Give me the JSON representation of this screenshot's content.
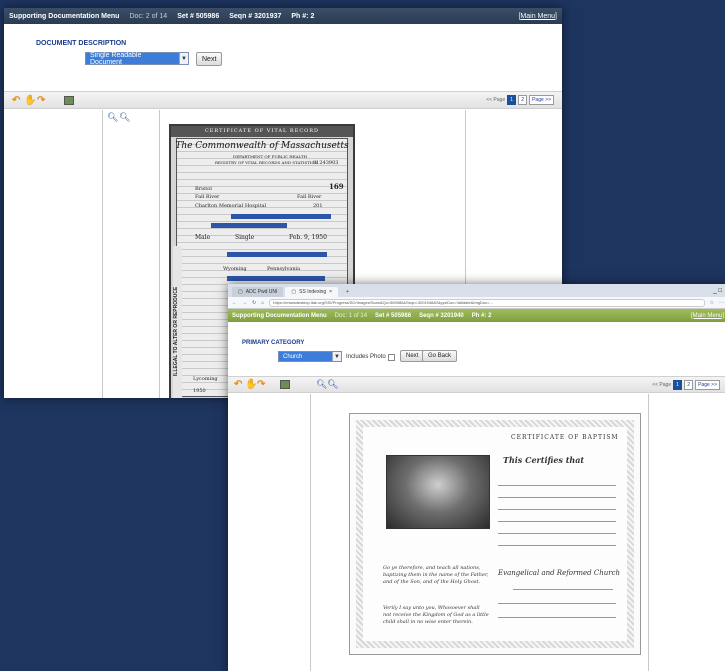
{
  "back_window": {
    "header": {
      "menu_title": "Supporting Documentation Menu",
      "doc_count": "Doc: 2 of 14",
      "set": "Set # 505986",
      "seqn": "Seqn # 3201937",
      "ph": "Ph #: 2",
      "main_menu": "[Main Menu]"
    },
    "section_label": "DOCUMENT DESCRIPTION",
    "select_value": "Single Readable Document",
    "next_button": "Next",
    "pager": {
      "prev": "<< Page",
      "pages": [
        "1",
        "2"
      ],
      "next": "Page >>"
    },
    "document": {
      "top_banner": "CERTIFICATE OF VITAL RECORD",
      "commonwealth": "The Commonwealth of Massachusetts",
      "dept": "DEPARTMENT OF PUBLIC HEALTH",
      "registry": "REGISTRY OF VITAL RECORDS AND STATISTICS",
      "number_top": "81243903",
      "number_right": "169",
      "side_text": "ILLEGAL TO ALTER OR REPRODUCE",
      "fields": [
        "Bristol",
        "Fall River",
        "Fall River",
        "Charlton Memorial Hospital",
        "201",
        "Male",
        "Single",
        "Feb. 9, 1950",
        "Wyoming",
        "Pennsylvania",
        "Lycoming",
        "1950"
      ]
    }
  },
  "front_window": {
    "browser": {
      "tab1": "ADC Pwd UNI",
      "tab2": "SS Indexing",
      "url": "https://emwsdesktop.ilae.org/SSI/Progress/SO/Images/Scan&Qc=505986&Seqn=3201948&SkypeDoc=Validate&ImgDoc=...",
      "window_controls": "_ □"
    },
    "header": {
      "menu_title": "Supporting Documentation Menu",
      "doc_count": "Doc: 1 of 14",
      "set": "Set # 505986",
      "seqn": "Seqn # 3201940",
      "ph": "Ph #: 2",
      "main_menu": "[Main Menu]"
    },
    "section_label": "PRIMARY CATEGORY",
    "select_value": "Church",
    "includes_photo_label": "Includes Photo",
    "next_button": "Next",
    "go_back_button": "Go Back",
    "pager": {
      "prev": "<< Page",
      "pages": [
        "1",
        "2"
      ],
      "next": "Page >>"
    },
    "document": {
      "title": "CERTIFICATE OF BAPTISM",
      "subtitle": "This Certifies that",
      "church": "Evangelical and Reformed Church",
      "scripture1": "Go ye therefore, and teach all nations, baptizing them in the name of the Father, and of the Son, and of the Holy Ghost.",
      "scripture2": "Verily I say unto you, Whosoever shall not receive the Kingdom of God as a little child shall in no wise enter therein."
    }
  }
}
